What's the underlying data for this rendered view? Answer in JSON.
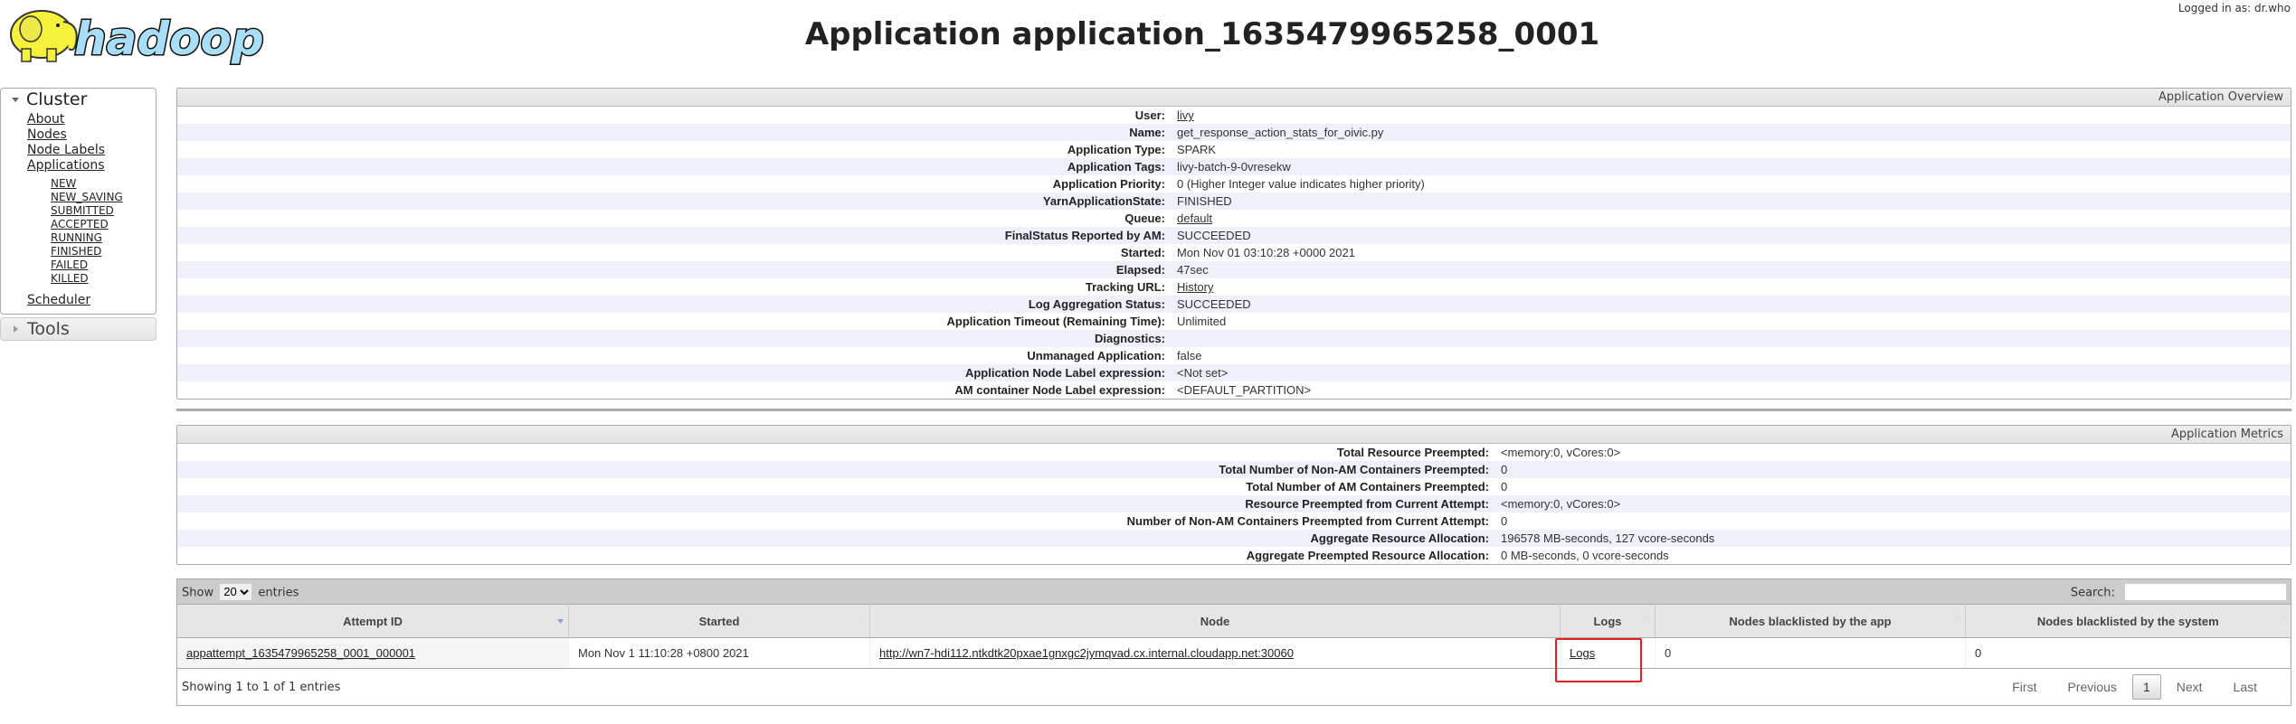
{
  "header": {
    "logo_text": "hadoop",
    "logged_in": "Logged in as: dr.who",
    "title": "Application application_1635479965258_0001"
  },
  "sidebar": {
    "cluster": {
      "label": "Cluster",
      "items": [
        "About",
        "Nodes",
        "Node Labels",
        "Applications"
      ],
      "app_states": [
        "NEW",
        "NEW_SAVING",
        "SUBMITTED",
        "ACCEPTED",
        "RUNNING",
        "FINISHED",
        "FAILED",
        "KILLED"
      ],
      "scheduler": "Scheduler"
    },
    "tools": {
      "label": "Tools"
    }
  },
  "overview": {
    "title": "Application Overview",
    "rows": [
      {
        "label": "User:",
        "value": "livy",
        "link": true
      },
      {
        "label": "Name:",
        "value": "get_response_action_stats_for_oivic.py"
      },
      {
        "label": "Application Type:",
        "value": "SPARK"
      },
      {
        "label": "Application Tags:",
        "value": "livy-batch-9-0vresekw"
      },
      {
        "label": "Application Priority:",
        "value": "0 (Higher Integer value indicates higher priority)"
      },
      {
        "label": "YarnApplicationState:",
        "value": "FINISHED"
      },
      {
        "label": "Queue:",
        "value": "default",
        "link": true
      },
      {
        "label": "FinalStatus Reported by AM:",
        "value": "SUCCEEDED"
      },
      {
        "label": "Started:",
        "value": "Mon Nov 01 03:10:28 +0000 2021"
      },
      {
        "label": "Elapsed:",
        "value": "47sec"
      },
      {
        "label": "Tracking URL:",
        "value": "History",
        "link": true
      },
      {
        "label": "Log Aggregation Status:",
        "value": "SUCCEEDED"
      },
      {
        "label": "Application Timeout (Remaining Time):",
        "value": "Unlimited"
      },
      {
        "label": "Diagnostics:",
        "value": ""
      },
      {
        "label": "Unmanaged Application:",
        "value": "false"
      },
      {
        "label": "Application Node Label expression:",
        "value": "<Not set>"
      },
      {
        "label": "AM container Node Label expression:",
        "value": "<DEFAULT_PARTITION>"
      }
    ]
  },
  "metrics": {
    "title": "Application Metrics",
    "rows": [
      {
        "label": "Total Resource Preempted:",
        "value": "<memory:0, vCores:0>"
      },
      {
        "label": "Total Number of Non-AM Containers Preempted:",
        "value": "0"
      },
      {
        "label": "Total Number of AM Containers Preempted:",
        "value": "0"
      },
      {
        "label": "Resource Preempted from Current Attempt:",
        "value": "<memory:0, vCores:0>"
      },
      {
        "label": "Number of Non-AM Containers Preempted from Current Attempt:",
        "value": "0"
      },
      {
        "label": "Aggregate Resource Allocation:",
        "value": "196578 MB-seconds, 127 vcore-seconds"
      },
      {
        "label": "Aggregate Preempted Resource Allocation:",
        "value": "0 MB-seconds, 0 vcore-seconds"
      }
    ]
  },
  "attempts": {
    "show_label": "Show",
    "entries_label": "entries",
    "page_size": "20",
    "search_label": "Search:",
    "search_value": "",
    "columns": [
      "Attempt ID",
      "Started",
      "Node",
      "Logs",
      "Nodes blacklisted by the app",
      "Nodes blacklisted by the system"
    ],
    "rows": [
      {
        "attempt_id": "appattempt_1635479965258_0001_000001",
        "started": "Mon Nov 1 11:10:28 +0800 2021",
        "node": "http://wn7-hdi112.ntkdtk20pxae1gnxgc2jymqvad.cx.internal.cloudapp.net:30060",
        "logs": "Logs",
        "blacklisted_app": "0",
        "blacklisted_system": "0"
      }
    ],
    "info": "Showing 1 to 1 of 1 entries",
    "pager": {
      "first": "First",
      "previous": "Previous",
      "current": "1",
      "next": "Next",
      "last": "Last"
    },
    "highlight_color": "#e51f1f"
  }
}
